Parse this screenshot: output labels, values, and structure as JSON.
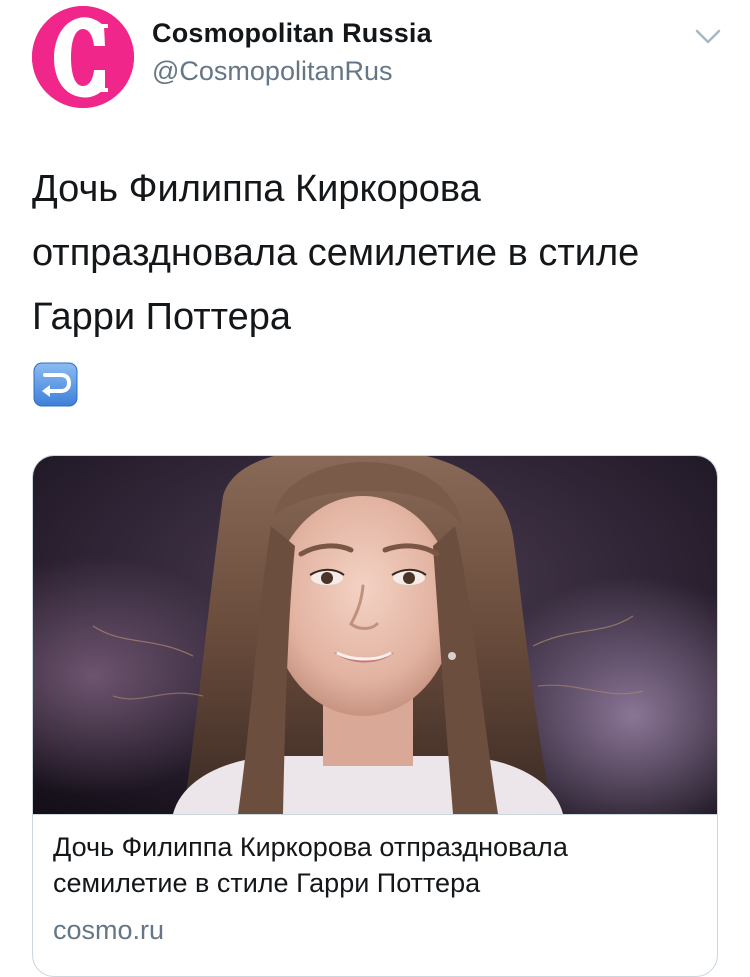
{
  "tweet": {
    "author": {
      "display_name": "Cosmopolitan Russia",
      "handle": "@CosmopolitanRus",
      "avatar_letter": "C",
      "avatar_color": "#f0268a"
    },
    "text_lines": [
      "Дочь Филиппа Киркорова",
      "отпраздновала семилетие в стиле",
      "Гарри Поттера"
    ],
    "emoji": "right-arrow-curving-left-icon",
    "link_card": {
      "image": "photo-of-smiling-girl-with-long-hair",
      "title_lines": [
        "Дочь Филиппа Киркорова отпраздновала",
        "семилетие в стиле Гарри Поттера"
      ],
      "domain": "cosmo.ru"
    }
  },
  "colors": {
    "text": "#14171a",
    "secondary": "#657786",
    "border": "#ccd6dd",
    "brand_pink": "#f0268a",
    "emoji_blue": "#4e8fe0"
  }
}
